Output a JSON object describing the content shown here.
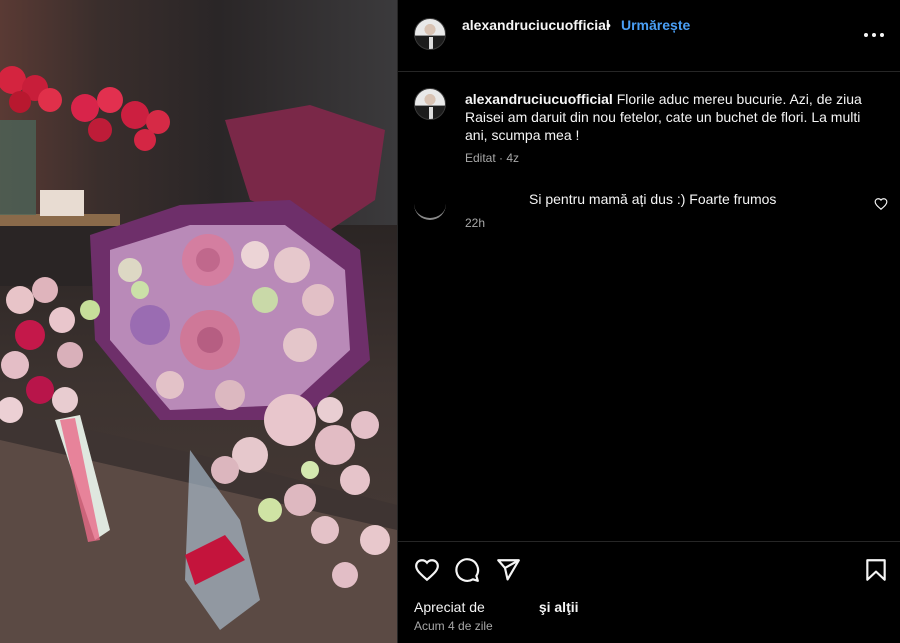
{
  "post": {
    "username": "alexandruciucuofficial",
    "separator": "•",
    "follow_label": "Urmărește",
    "caption": "Florile aduc mereu bucurie. Azi, de ziua Raisei am daruit din nou fetelor, cate un buchet de flori. La multi ani, scumpa mea !",
    "caption_meta": "Editat · 4z"
  },
  "comment": {
    "text": "Si pentru mamă ați dus :) Foarte frumos",
    "time": "22h"
  },
  "footer": {
    "likes_prefix": "Apreciat de",
    "likes_suffix": "şi alţii",
    "date": "Acum 4 de zile"
  },
  "icons": {
    "more": "more-icon",
    "heart": "heart-icon",
    "comment": "comment-icon",
    "share": "share-icon",
    "save": "bookmark-icon"
  },
  "colors": {
    "background": "#000000",
    "link": "#4a9ff5",
    "muted": "#a8a8a8"
  }
}
